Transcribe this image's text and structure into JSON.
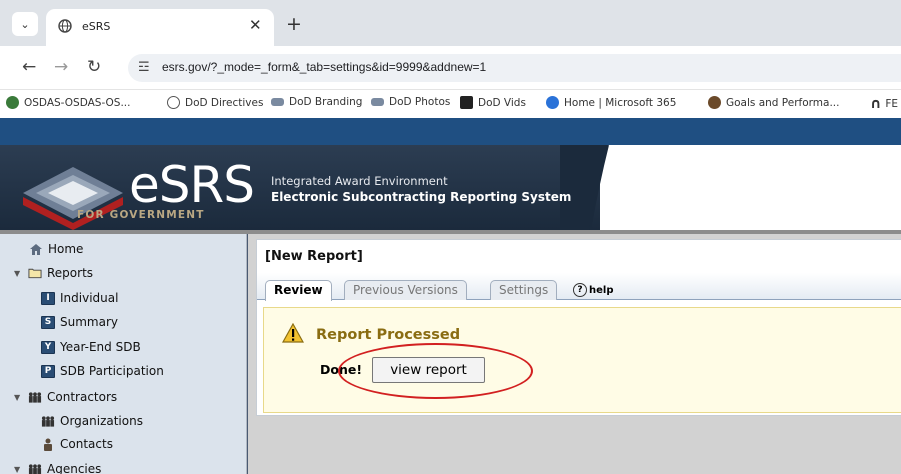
{
  "browser": {
    "tab_menu_glyph": "⌄",
    "tab_title": "eSRS",
    "tab_close": "✕",
    "new_tab": "+",
    "back_glyph": "←",
    "forward_glyph": "→",
    "reload_glyph": "↻",
    "site_settings_glyph": "☲",
    "url": "esrs.gov/?_mode=_form&_tab=settings&id=9999&addnew=1",
    "bookmarks": [
      {
        "label": "OSDAS-OSDAS-OS...",
        "color": "#3a7a3a"
      },
      {
        "label": "DoD Directives",
        "color": "#555555"
      },
      {
        "label": "DoD Branding",
        "color": "#7a8aa0"
      },
      {
        "label": "DoD Photos",
        "color": "#7a8aa0"
      },
      {
        "label": "DoD Vids",
        "color": "#222222"
      },
      {
        "label": "Home | Microsoft 365",
        "color": "#2a72d8"
      },
      {
        "label": "Goals and Performa...",
        "color": "#6b4a2a"
      },
      {
        "label": "FE",
        "color": "#222222"
      }
    ]
  },
  "banner": {
    "logo_text": "eSRS",
    "logo_sub": "FOR GOVERNMENT",
    "tag_line_1": "Integrated Award Environment",
    "tag_line_2": "Electronic Subcontracting Reporting System"
  },
  "sidebar": {
    "items": [
      {
        "label": "Home",
        "icon": "home-icon"
      },
      {
        "label": "Reports",
        "icon": "folder-icon"
      },
      {
        "label": "Individual",
        "icon": "I"
      },
      {
        "label": "Summary",
        "icon": "S"
      },
      {
        "label": "Year-End SDB",
        "icon": "Y"
      },
      {
        "label": "SDB Participation",
        "icon": "P"
      },
      {
        "label": "Contractors",
        "icon": "people-icon"
      },
      {
        "label": "Organizations",
        "icon": "people-icon"
      },
      {
        "label": "Contacts",
        "icon": "person-icon"
      },
      {
        "label": "Agencies",
        "icon": "people-icon"
      }
    ]
  },
  "content": {
    "report_title": "[New Report]",
    "tabs": [
      {
        "label": "Review",
        "active": true
      },
      {
        "label": "Previous Versions",
        "active": false
      },
      {
        "label": "Settings",
        "active": false
      }
    ],
    "help_label": "help",
    "status_title": "Report Processed",
    "done_label": "Done!",
    "view_report_label": "view report"
  },
  "colors": {
    "header_blue": "#1f4f82",
    "sidebar_bg": "#dbe3ec",
    "status_gold": "#8a6d12",
    "annotation_red": "#d22020"
  }
}
